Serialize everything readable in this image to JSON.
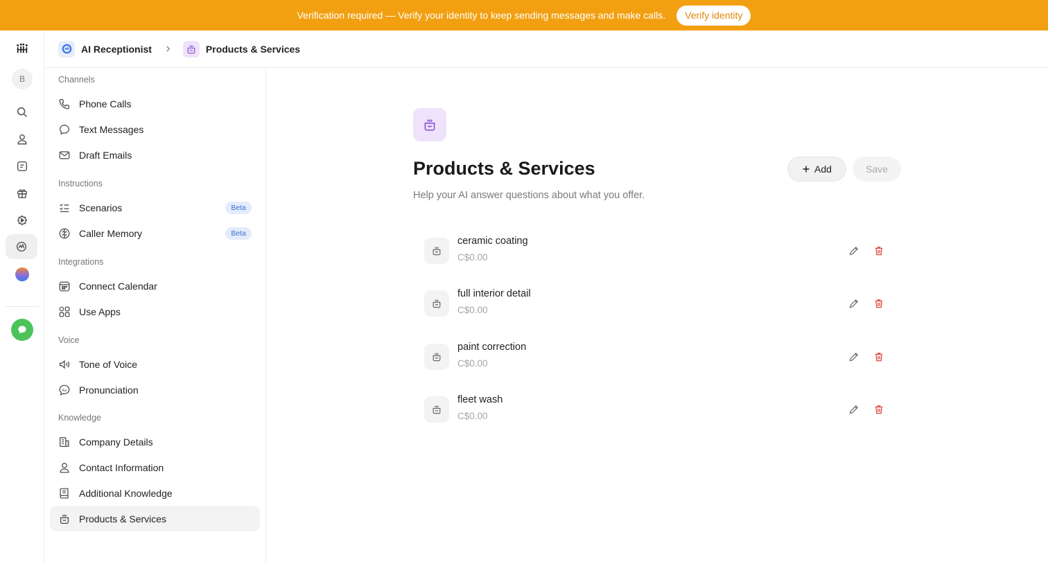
{
  "banner": {
    "message": "Verification required — Verify your identity to keep sending messages and make calls.",
    "button_label": "Verify identity"
  },
  "rail": {
    "avatar_initial": "B",
    "icons": [
      "logo-icon",
      "search-icon",
      "person-icon",
      "note-icon",
      "gift-icon",
      "gear-play-icon",
      "ai-receptionist-icon",
      "orb-icon",
      "chat-icon"
    ]
  },
  "breadcrumb": {
    "root_label": "AI Receptionist",
    "current_label": "Products & Services"
  },
  "sidebar": {
    "sections": [
      {
        "label": "Channels",
        "items": [
          {
            "label": "Phone Calls",
            "icon": "phone-icon"
          },
          {
            "label": "Text Messages",
            "icon": "message-icon"
          },
          {
            "label": "Draft Emails",
            "icon": "mail-icon"
          }
        ]
      },
      {
        "label": "Instructions",
        "items": [
          {
            "label": "Scenarios",
            "icon": "checklist-icon",
            "badge": "Beta"
          },
          {
            "label": "Caller Memory",
            "icon": "brain-icon",
            "badge": "Beta"
          }
        ]
      },
      {
        "label": "Integrations",
        "items": [
          {
            "label": "Connect Calendar",
            "icon": "calendar-icon"
          },
          {
            "label": "Use Apps",
            "icon": "apps-icon"
          }
        ]
      },
      {
        "label": "Voice",
        "items": [
          {
            "label": "Tone of Voice",
            "icon": "speaker-icon"
          },
          {
            "label": "Pronunciation",
            "icon": "pronunciation-icon"
          }
        ]
      },
      {
        "label": "Knowledge",
        "items": [
          {
            "label": "Company Details",
            "icon": "building-icon"
          },
          {
            "label": "Contact Information",
            "icon": "person-icon"
          },
          {
            "label": "Additional Knowledge",
            "icon": "book-icon"
          },
          {
            "label": "Products & Services",
            "icon": "product-icon",
            "active": true
          }
        ]
      }
    ]
  },
  "main": {
    "title": "Products & Services",
    "subtitle": "Help your AI answer questions about what you offer.",
    "add_label": "Add",
    "save_label": "Save",
    "products": [
      {
        "name": "ceramic coating",
        "price": "C$0.00"
      },
      {
        "name": "full interior detail",
        "price": "C$0.00"
      },
      {
        "name": "paint correction",
        "price": "C$0.00"
      },
      {
        "name": "fleet wash",
        "price": "C$0.00"
      }
    ]
  },
  "colors": {
    "banner": "#f2a012",
    "accent_purple": "#8f5bd6",
    "delete_red": "#e0483e",
    "beta_badge": "#3b6fd6"
  }
}
